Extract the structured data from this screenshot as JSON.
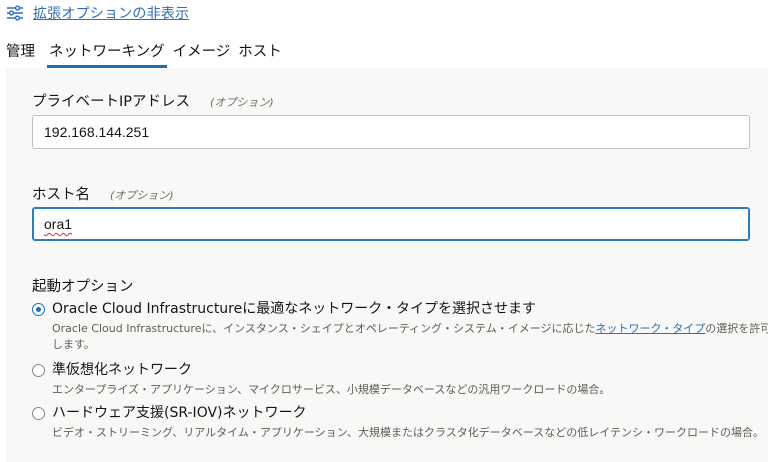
{
  "header": {
    "toggle_label": "拡張オプションの非表示"
  },
  "tabs": [
    {
      "label": "管理",
      "active": false
    },
    {
      "label": "ネットワーキング",
      "active": true
    },
    {
      "label": "イメージ",
      "active": false
    },
    {
      "label": "ホスト",
      "active": false
    }
  ],
  "private_ip": {
    "label": "プライベートIPアドレス",
    "optional": "(オプション)",
    "value": "192.168.144.251"
  },
  "hostname": {
    "label": "ホスト名",
    "optional": "(オプション)",
    "value": "ora1"
  },
  "launch_options": {
    "title": "起動オプション",
    "options": [
      {
        "label": "Oracle Cloud Infrastructureに最適なネットワーク・タイプを選択させます",
        "desc_before": "Oracle Cloud Infrastructureに、インスタンス・シェイプとオペレーティング・システム・イメージに応じた",
        "desc_link": "ネットワーク・タイプ",
        "desc_after": "の選択を許可します。",
        "selected": true
      },
      {
        "label": "準仮想化ネットワーク",
        "desc": "エンタープライズ・アプリケーション、マイクロサービス、小規模データベースなどの汎用ワークロードの場合。",
        "selected": false
      },
      {
        "label": "ハードウェア支援(SR-IOV)ネットワーク",
        "desc": "ビデオ・ストリーミング、リアルタイム・アプリケーション、大規模またはクラスタ化データベースなどの低レイテンシ・ワークロードの場合。",
        "selected": false
      }
    ]
  },
  "colors": {
    "accent": "#1b6fb5",
    "link": "#2c6fb3"
  }
}
